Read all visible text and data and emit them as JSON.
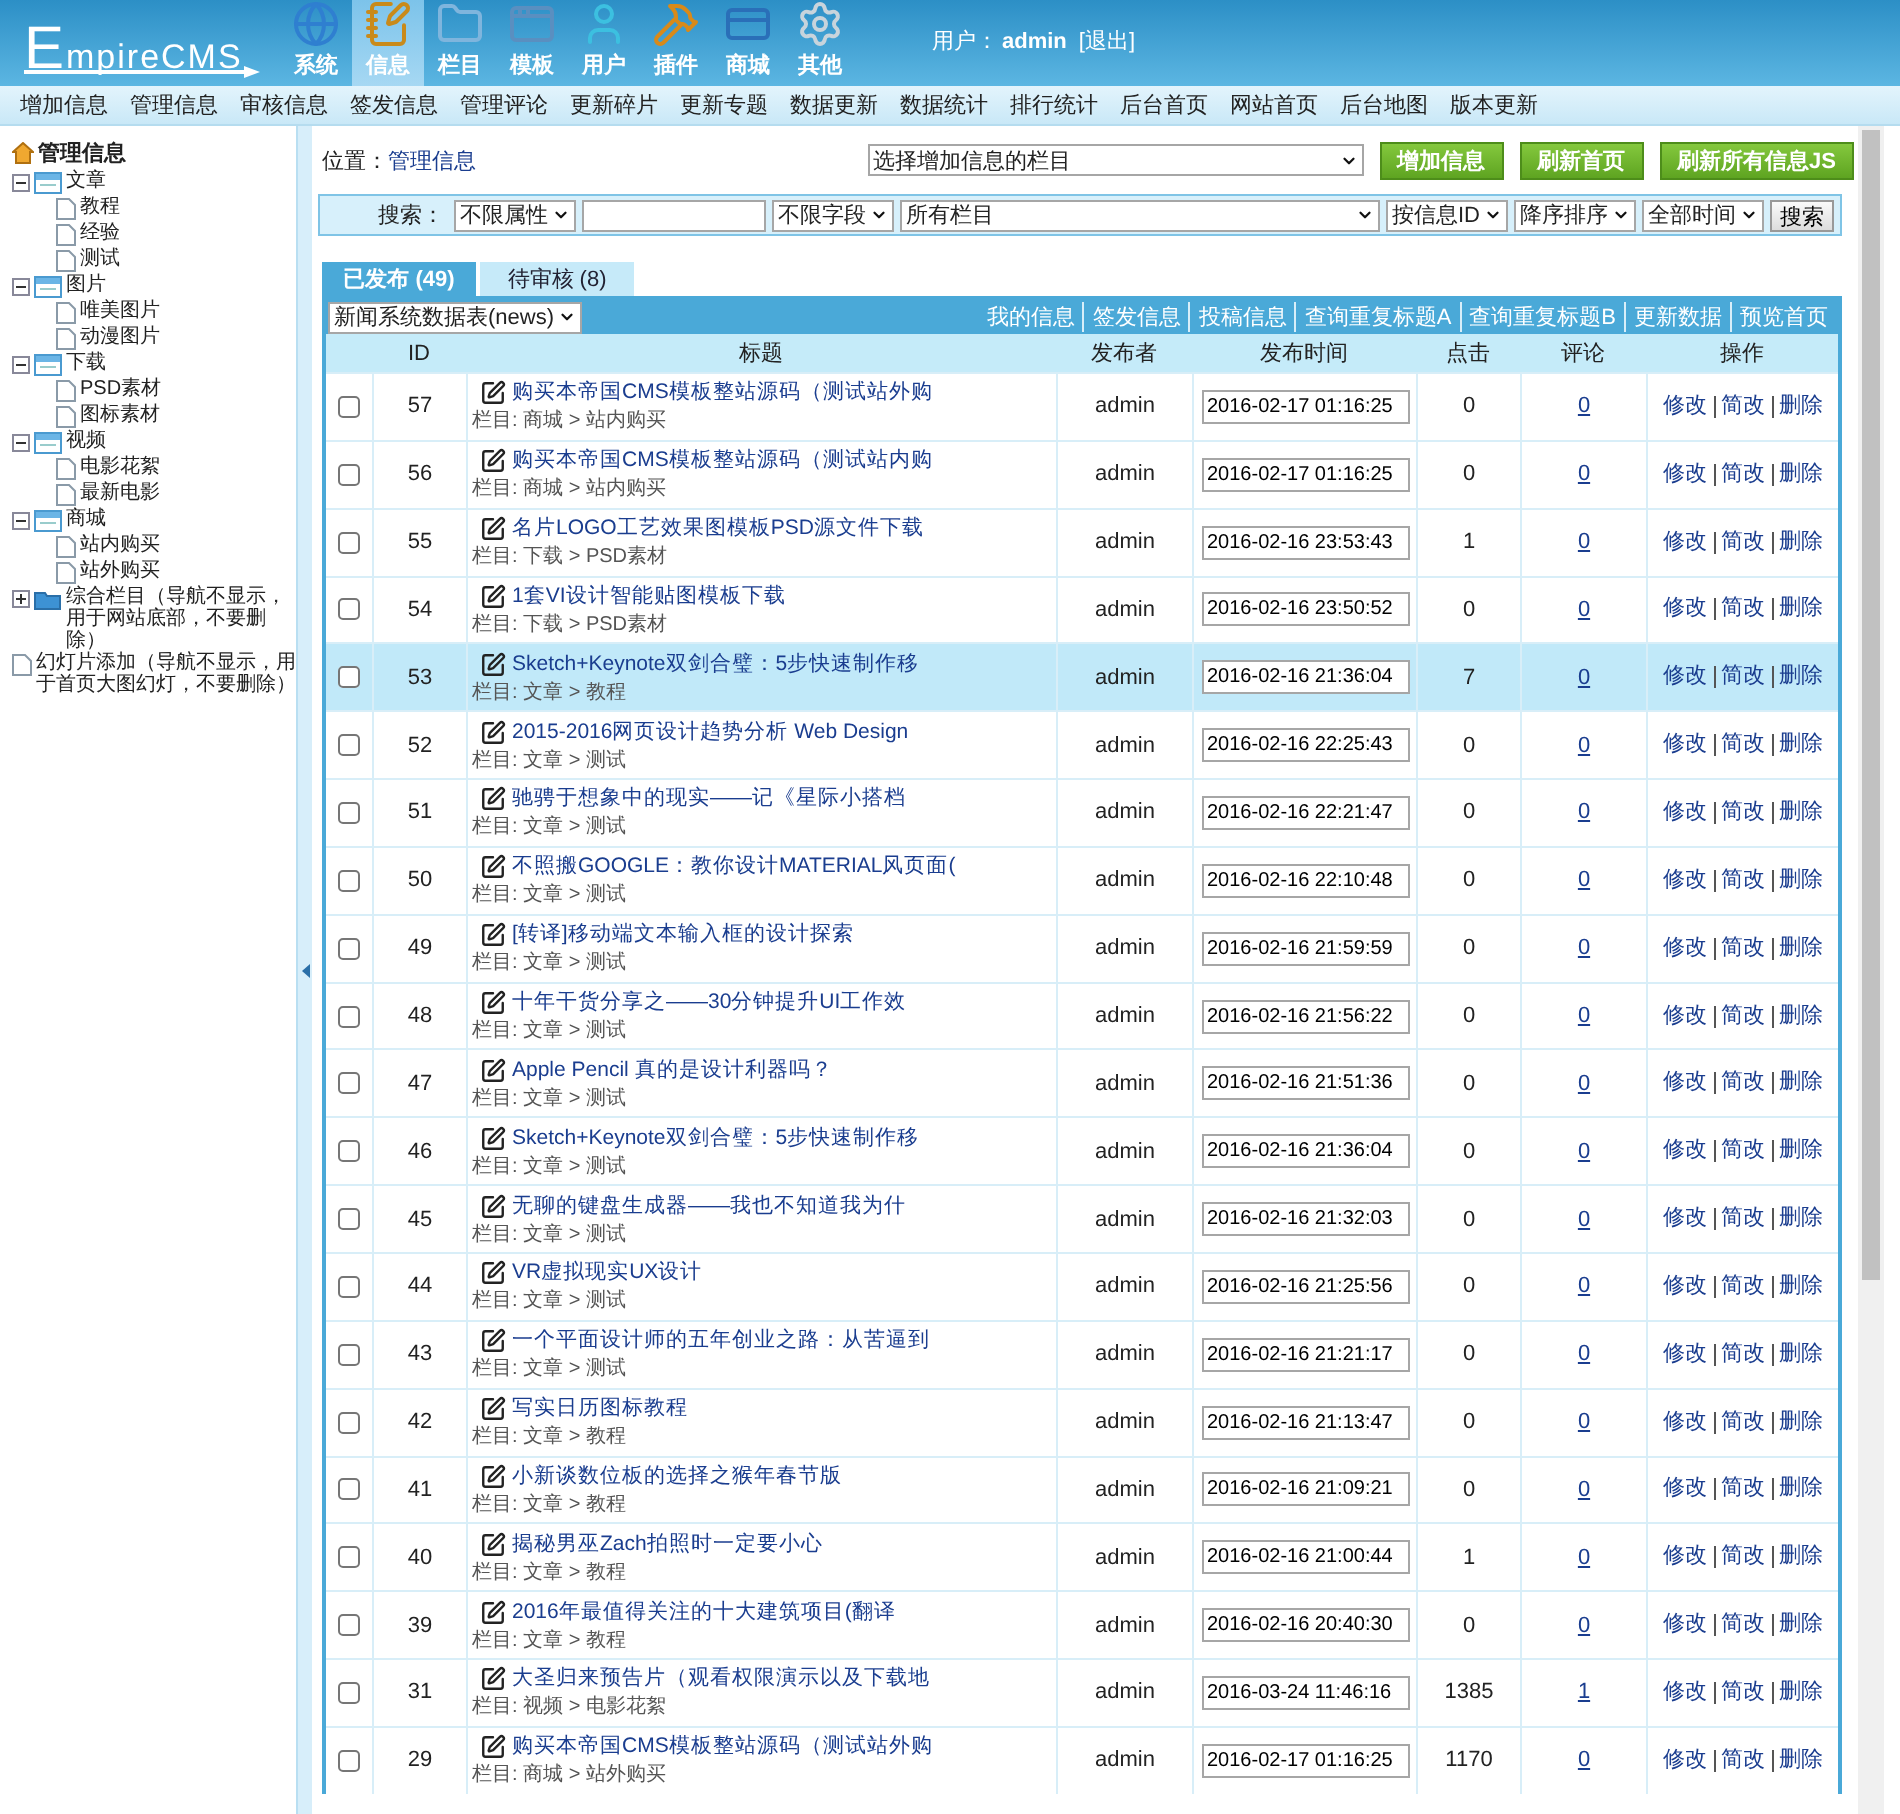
{
  "header": {
    "logo": "EmpireCMS",
    "nav": [
      {
        "label": "系统",
        "kind": "globe",
        "selected": false
      },
      {
        "label": "信息",
        "kind": "note",
        "selected": true
      },
      {
        "label": "栏目",
        "kind": "folder",
        "selected": false
      },
      {
        "label": "模板",
        "kind": "window",
        "selected": false
      },
      {
        "label": "用户",
        "kind": "user",
        "selected": false
      },
      {
        "label": "插件",
        "kind": "tools",
        "selected": false
      },
      {
        "label": "商城",
        "kind": "card",
        "selected": false
      },
      {
        "label": "其他",
        "kind": "gear",
        "selected": false
      }
    ],
    "user_label": "用户：",
    "user_name": "admin",
    "logout": "[退出]"
  },
  "subnav": [
    "增加信息",
    "管理信息",
    "审核信息",
    "签发信息",
    "管理评论",
    "更新碎片",
    "更新专题",
    "数据更新",
    "数据统计",
    "排行统计",
    "后台首页",
    "网站首页",
    "后台地图",
    "版本更新"
  ],
  "sidebar": {
    "title": "管理信息",
    "tree": [
      {
        "label": "文章",
        "kind": "folder",
        "expanded": true,
        "children": [
          {
            "label": "教程",
            "kind": "page"
          },
          {
            "label": "经验",
            "kind": "page"
          },
          {
            "label": "测试",
            "kind": "page"
          }
        ]
      },
      {
        "label": "图片",
        "kind": "folder",
        "expanded": true,
        "children": [
          {
            "label": "唯美图片",
            "kind": "page"
          },
          {
            "label": "动漫图片",
            "kind": "page"
          }
        ]
      },
      {
        "label": "下载",
        "kind": "folder",
        "expanded": true,
        "children": [
          {
            "label": "PSD素材",
            "kind": "page"
          },
          {
            "label": "图标素材",
            "kind": "page"
          }
        ]
      },
      {
        "label": "视频",
        "kind": "folder",
        "expanded": true,
        "children": [
          {
            "label": "电影花絮",
            "kind": "page"
          },
          {
            "label": "最新电影",
            "kind": "page"
          }
        ]
      },
      {
        "label": "商城",
        "kind": "folder",
        "expanded": true,
        "children": [
          {
            "label": "站内购买",
            "kind": "page"
          },
          {
            "label": "站外购买",
            "kind": "page"
          }
        ]
      },
      {
        "label": "综合栏目（导航不显示，用于网站底部，不要删除）",
        "kind": "folder",
        "expanded": false
      },
      {
        "label": "幻灯片添加（导航不显示，用于首页大图幻灯，不要删除）",
        "kind": "page"
      }
    ]
  },
  "location": {
    "label": "位置：",
    "value": "管理信息"
  },
  "column_select": "选择增加信息的栏目",
  "actions": [
    "增加信息",
    "刷新首页",
    "刷新所有信息JS"
  ],
  "search": {
    "label": "搜索：",
    "attribute": "不限属性",
    "field": "不限字段",
    "column": "所有栏目",
    "order_by": "按信息ID",
    "order": "降序排序",
    "time": "全部时间",
    "button": "搜索"
  },
  "tabs": [
    {
      "label": "已发布 (49)",
      "selected": true
    },
    {
      "label": "待审核 (8)",
      "selected": false
    }
  ],
  "table": {
    "source": "新闻系统数据表(news)",
    "links": [
      "我的信息",
      "签发信息",
      "投稿信息",
      "查询重复标题A",
      "查询重复标题B",
      "更新数据",
      "预览首页"
    ],
    "columns": [
      "ID",
      "标题",
      "发布者",
      "发布时间",
      "点击",
      "评论",
      "操作"
    ],
    "rows": [
      {
        "id": "57",
        "title": "购买本帝国CMS模板整站源码（测试站外购",
        "category": "栏目: 商城 > 站内购买",
        "author": "admin",
        "time": "2016-02-17 01:16:25",
        "hits": "0",
        "comments": "0",
        "ops": [
          "修改",
          "简改",
          "删除"
        ],
        "checked": false,
        "selected": false
      },
      {
        "id": "56",
        "title": "购买本帝国CMS模板整站源码（测试站内购",
        "category": "栏目: 商城 > 站内购买",
        "author": "admin",
        "time": "2016-02-17 01:16:25",
        "hits": "0",
        "comments": "0",
        "ops": [
          "修改",
          "简改",
          "删除"
        ],
        "checked": false,
        "selected": false
      },
      {
        "id": "55",
        "title": "名片LOGO工艺效果图模板PSD源文件下载",
        "category": "栏目: 下载 > PSD素材",
        "author": "admin",
        "time": "2016-02-16 23:53:43",
        "hits": "1",
        "comments": "0",
        "ops": [
          "修改",
          "简改",
          "删除"
        ],
        "checked": false,
        "selected": false
      },
      {
        "id": "54",
        "title": "1套VI设计智能贴图模板下载",
        "category": "栏目: 下载 > PSD素材",
        "author": "admin",
        "time": "2016-02-16 23:50:52",
        "hits": "0",
        "comments": "0",
        "ops": [
          "修改",
          "简改",
          "删除"
        ],
        "checked": false,
        "selected": false
      },
      {
        "id": "53",
        "title": "Sketch+Keynote双剑合璧：5步快速制作移",
        "category": "栏目: 文章 > 教程",
        "author": "admin",
        "time": "2016-02-16 21:36:04",
        "hits": "7",
        "comments": "0",
        "ops": [
          "修改",
          "简改",
          "删除"
        ],
        "checked": false,
        "selected": true
      },
      {
        "id": "52",
        "title": "2015-2016网页设计趋势分析 Web Design",
        "category": "栏目: 文章 > 测试",
        "author": "admin",
        "time": "2016-02-16 22:25:43",
        "hits": "0",
        "comments": "0",
        "ops": [
          "修改",
          "简改",
          "删除"
        ],
        "checked": false,
        "selected": false
      },
      {
        "id": "51",
        "title": "驰骋于想象中的现实——记《星际小搭档",
        "category": "栏目: 文章 > 测试",
        "author": "admin",
        "time": "2016-02-16 22:21:47",
        "hits": "0",
        "comments": "0",
        "ops": [
          "修改",
          "简改",
          "删除"
        ],
        "checked": false,
        "selected": false
      },
      {
        "id": "50",
        "title": "不照搬GOOGLE：教你设计MATERIAL风页面(",
        "category": "栏目: 文章 > 测试",
        "author": "admin",
        "time": "2016-02-16 22:10:48",
        "hits": "0",
        "comments": "0",
        "ops": [
          "修改",
          "简改",
          "删除"
        ],
        "checked": false,
        "selected": false
      },
      {
        "id": "49",
        "title": "[转译]移动端文本输入框的设计探索",
        "category": "栏目: 文章 > 测试",
        "author": "admin",
        "time": "2016-02-16 21:59:59",
        "hits": "0",
        "comments": "0",
        "ops": [
          "修改",
          "简改",
          "删除"
        ],
        "checked": false,
        "selected": false
      },
      {
        "id": "48",
        "title": "十年干货分享之——30分钟提升UI工作效",
        "category": "栏目: 文章 > 测试",
        "author": "admin",
        "time": "2016-02-16 21:56:22",
        "hits": "0",
        "comments": "0",
        "ops": [
          "修改",
          "简改",
          "删除"
        ],
        "checked": false,
        "selected": false
      },
      {
        "id": "47",
        "title": "Apple Pencil 真的是设计利器吗？",
        "category": "栏目: 文章 > 测试",
        "author": "admin",
        "time": "2016-02-16 21:51:36",
        "hits": "0",
        "comments": "0",
        "ops": [
          "修改",
          "简改",
          "删除"
        ],
        "checked": false,
        "selected": false
      },
      {
        "id": "46",
        "title": "Sketch+Keynote双剑合璧：5步快速制作移",
        "category": "栏目: 文章 > 测试",
        "author": "admin",
        "time": "2016-02-16 21:36:04",
        "hits": "0",
        "comments": "0",
        "ops": [
          "修改",
          "简改",
          "删除"
        ],
        "checked": false,
        "selected": false
      },
      {
        "id": "45",
        "title": "无聊的键盘生成器——我也不知道我为什",
        "category": "栏目: 文章 > 测试",
        "author": "admin",
        "time": "2016-02-16 21:32:03",
        "hits": "0",
        "comments": "0",
        "ops": [
          "修改",
          "简改",
          "删除"
        ],
        "checked": false,
        "selected": false
      },
      {
        "id": "44",
        "title": "VR虚拟现实UX设计",
        "category": "栏目: 文章 > 测试",
        "author": "admin",
        "time": "2016-02-16 21:25:56",
        "hits": "0",
        "comments": "0",
        "ops": [
          "修改",
          "简改",
          "删除"
        ],
        "checked": false,
        "selected": false
      },
      {
        "id": "43",
        "title": "一个平面设计师的五年创业之路：从苦逼到",
        "category": "栏目: 文章 > 测试",
        "author": "admin",
        "time": "2016-02-16 21:21:17",
        "hits": "0",
        "comments": "0",
        "ops": [
          "修改",
          "简改",
          "删除"
        ],
        "checked": false,
        "selected": false
      },
      {
        "id": "42",
        "title": "写实日历图标教程",
        "category": "栏目: 文章 > 教程",
        "author": "admin",
        "time": "2016-02-16 21:13:47",
        "hits": "0",
        "comments": "0",
        "ops": [
          "修改",
          "简改",
          "删除"
        ],
        "checked": false,
        "selected": false
      },
      {
        "id": "41",
        "title": "小新谈数位板的选择之猴年春节版",
        "category": "栏目: 文章 > 教程",
        "author": "admin",
        "time": "2016-02-16 21:09:21",
        "hits": "0",
        "comments": "0",
        "ops": [
          "修改",
          "简改",
          "删除"
        ],
        "checked": false,
        "selected": false
      },
      {
        "id": "40",
        "title": "揭秘男巫Zach拍照时一定要小心",
        "category": "栏目: 文章 > 教程",
        "author": "admin",
        "time": "2016-02-16 21:00:44",
        "hits": "1",
        "comments": "0",
        "ops": [
          "修改",
          "简改",
          "删除"
        ],
        "checked": false,
        "selected": false
      },
      {
        "id": "39",
        "title": "2016年最值得关注的十大建筑项目(翻译",
        "category": "栏目: 文章 > 教程",
        "author": "admin",
        "time": "2016-02-16 20:40:30",
        "hits": "0",
        "comments": "0",
        "ops": [
          "修改",
          "简改",
          "删除"
        ],
        "checked": false,
        "selected": false
      },
      {
        "id": "31",
        "title": "大圣归来预告片（观看权限演示以及下载地",
        "category": "栏目: 视频 > 电影花絮",
        "author": "admin",
        "time": "2016-03-24 11:46:16",
        "hits": "1385",
        "comments": "1",
        "ops": [
          "修改",
          "简改",
          "删除"
        ],
        "checked": false,
        "selected": false
      },
      {
        "id": "29",
        "title": "购买本帝国CMS模板整站源码（测试站外购",
        "category": "栏目: 商城 > 站外购买",
        "author": "admin",
        "time": "2016-02-17 01:16:25",
        "hits": "1170",
        "comments": "0",
        "ops": [
          "修改",
          "简改",
          "删除"
        ],
        "checked": false,
        "selected": false
      }
    ]
  }
}
